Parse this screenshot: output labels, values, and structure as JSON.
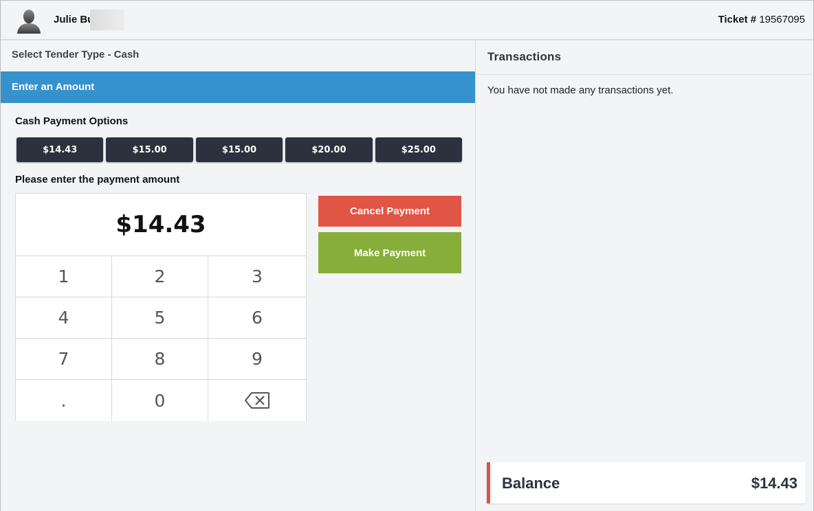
{
  "header": {
    "user_name": "Julie Bu",
    "ticket_label": "Ticket #",
    "ticket_number": "19567095",
    "avatar_icon": "user-silhouette-icon"
  },
  "left": {
    "tender_title": "Select Tender Type - Cash",
    "amount_bar": "Enter an Amount",
    "cash_options_label": "Cash Payment Options",
    "cash_options": [
      "$14.43",
      "$15.00",
      "$15.00",
      "$20.00",
      "$25.00"
    ],
    "payment_amount_label": "Please enter the payment amount",
    "display_amount": "$14.43",
    "keys": [
      "1",
      "2",
      "3",
      "4",
      "5",
      "6",
      "7",
      "8",
      "9",
      ".",
      "0"
    ],
    "backspace_icon": "backspace-icon",
    "cancel_label": "Cancel Payment",
    "make_label": "Make Payment"
  },
  "right": {
    "title": "Transactions",
    "empty_message": "You have not made any transactions yet.",
    "balance_label": "Balance",
    "balance_value": "$14.43"
  },
  "colors": {
    "accent_blue": "#3692cc",
    "cancel_red": "#e05546",
    "make_green": "#87ad3a",
    "dark_button": "#2b323d",
    "balance_border": "#d9534f"
  }
}
